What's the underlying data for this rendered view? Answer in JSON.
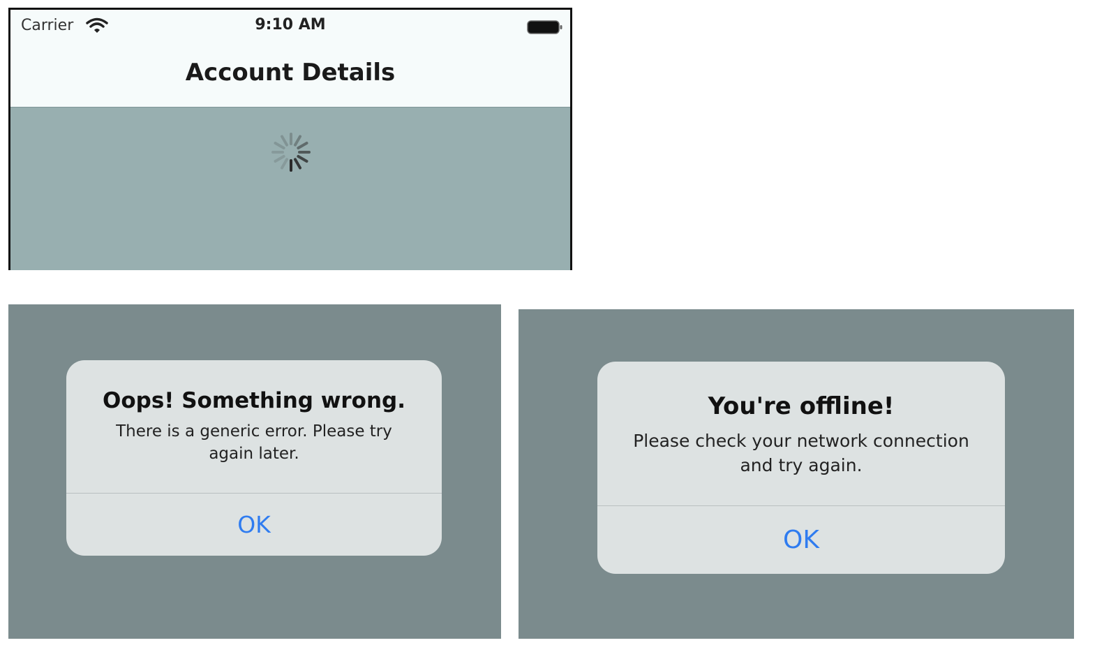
{
  "loading_screen": {
    "status_bar": {
      "carrier": "Carrier",
      "time": "9:10 AM",
      "wifi_icon": "wifi-icon",
      "battery_icon": "battery-icon"
    },
    "nav_title": "Account Details",
    "spinner_icon": "activity-spinner-icon",
    "overlay_color": "#98afb0"
  },
  "generic_error_alert": {
    "title": "Oops! Something wrong.",
    "message": "There is a generic error. Please try again later.",
    "ok_label": "OK"
  },
  "offline_alert": {
    "title": "You're offline!",
    "message": "Please check your network connection and try again.",
    "ok_label": "OK"
  },
  "colors": {
    "accent": "#2f7cf0",
    "dimmed_background": "#7b8b8d",
    "alert_background": "#dde2e2"
  }
}
